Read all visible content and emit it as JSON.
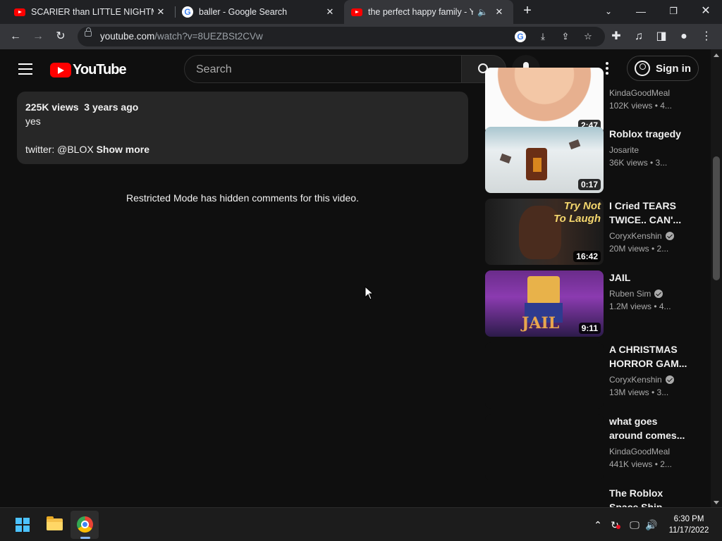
{
  "browser": {
    "tabs": [
      {
        "title": "SCARIER than LITTLE NIGHTMARES",
        "favicon": "youtube-favicon",
        "active": false
      },
      {
        "title": "baller - Google Search",
        "favicon": "google-favicon",
        "active": false
      },
      {
        "title": "the perfect happy family - YouTube",
        "favicon": "youtube-favicon",
        "active": true,
        "audio": true
      }
    ],
    "url_host": "youtube.com",
    "url_path": "/watch?v=8UEZBSt2CVw"
  },
  "masthead": {
    "logo_text": "YouTube",
    "search_placeholder": "Search",
    "signin_label": "Sign in"
  },
  "description": {
    "meta": "225K views  3 years ago",
    "line1": "yes",
    "line2_prefix": "twitter: @BLOX ",
    "show_more": "Show more"
  },
  "comments_notice": "Restricted Mode has hidden comments for this video.",
  "recommendations": [
    {
      "title": "",
      "channel": "KindaGoodMeal",
      "views": "102K views  • 4...",
      "duration": "2:47",
      "verified": false
    },
    {
      "title": "Roblox tragedy",
      "channel": "Josarite",
      "views": "36K views  • 3...",
      "duration": "0:17",
      "verified": false
    },
    {
      "title": "I Cried TEARS TWICE.. CAN'...",
      "channel": "CoryxKenshin",
      "views": "20M views  • 2...",
      "duration": "16:42",
      "verified": true,
      "thumb_text": [
        "Try Not",
        "To Laugh"
      ]
    },
    {
      "title": "JAIL",
      "channel": "Ruben Sim",
      "views": "1.2M views  • 4...",
      "duration": "9:11",
      "verified": true,
      "thumb_text": [
        "JAIL"
      ]
    },
    {
      "title": "A CHRISTMAS HORROR GAM...",
      "channel": "CoryxKenshin",
      "views": "13M views  • 3...",
      "duration": "",
      "verified": true
    },
    {
      "title": "what goes around comes...",
      "channel": "KindaGoodMeal",
      "views": "441K views  • 2...",
      "duration": "",
      "verified": false
    },
    {
      "title": "The Roblox Space Ship",
      "channel": "",
      "views": "",
      "duration": "",
      "verified": false
    }
  ],
  "taskbar": {
    "time": "6:30 PM",
    "date": "11/17/2022"
  },
  "colors": {
    "page_bg": "#0f0f0f",
    "card_bg": "#272727",
    "brand_red": "#ff0000",
    "text_secondary": "#aaaaaa"
  }
}
